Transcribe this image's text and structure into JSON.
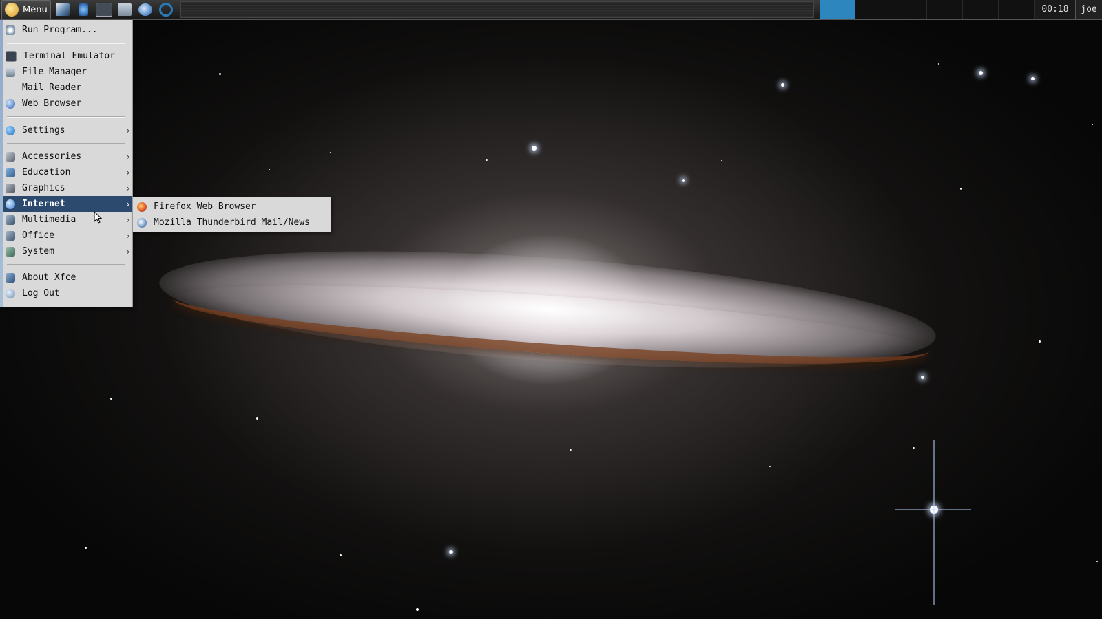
{
  "panel": {
    "menu_label": "Menu",
    "launchers": [
      {
        "icon": "text-editor-icon",
        "color": "#5a7fa8"
      },
      {
        "icon": "network-icon",
        "color": "#3f7fc9"
      },
      {
        "icon": "terminal-icon",
        "color": "#444c58"
      },
      {
        "icon": "file-manager-icon",
        "color": "#7d8e9e"
      },
      {
        "icon": "thunderbird-icon",
        "color": "#4f86c6"
      },
      {
        "icon": "refresh-browser-icon",
        "color": "#2a7ab8"
      }
    ],
    "workspaces": [
      {
        "active": true
      },
      {
        "active": false
      },
      {
        "active": false
      },
      {
        "active": false
      },
      {
        "active": false
      },
      {
        "active": false
      }
    ],
    "clock": "00:18",
    "user": "joe",
    "accent_color": "#2d86be"
  },
  "app_menu": {
    "items": [
      {
        "label": "Run Program...",
        "icon": "run-program-icon",
        "submenu": false
      },
      {
        "label": "Terminal Emulator",
        "icon": "terminal-icon",
        "submenu": false
      },
      {
        "label": "File Manager",
        "icon": "file-manager-icon",
        "submenu": false
      },
      {
        "label": "Mail Reader",
        "icon": "",
        "submenu": false
      },
      {
        "label": "Web Browser",
        "icon": "web-browser-icon",
        "submenu": false
      },
      {
        "label": "Settings",
        "icon": "settings-icon",
        "submenu": true
      },
      {
        "label": "Accessories",
        "icon": "accessories-icon",
        "submenu": true
      },
      {
        "label": "Education",
        "icon": "education-icon",
        "submenu": true
      },
      {
        "label": "Graphics",
        "icon": "graphics-icon",
        "submenu": true
      },
      {
        "label": "Internet",
        "icon": "internet-icon",
        "submenu": true,
        "highlighted": true
      },
      {
        "label": "Multimedia",
        "icon": "multimedia-icon",
        "submenu": true
      },
      {
        "label": "Office",
        "icon": "office-icon",
        "submenu": true
      },
      {
        "label": "System",
        "icon": "system-icon",
        "submenu": true
      },
      {
        "label": "About Xfce",
        "icon": "about-icon",
        "submenu": false
      },
      {
        "label": "Log Out",
        "icon": "log-out-icon",
        "submenu": false
      }
    ],
    "arrow": "›",
    "highlight_color": "#2c4a6e"
  },
  "internet_submenu": {
    "items": [
      {
        "label": "Firefox Web Browser",
        "icon": "firefox-icon"
      },
      {
        "label": "Mozilla Thunderbird Mail/News",
        "icon": "thunderbird-icon"
      }
    ]
  }
}
